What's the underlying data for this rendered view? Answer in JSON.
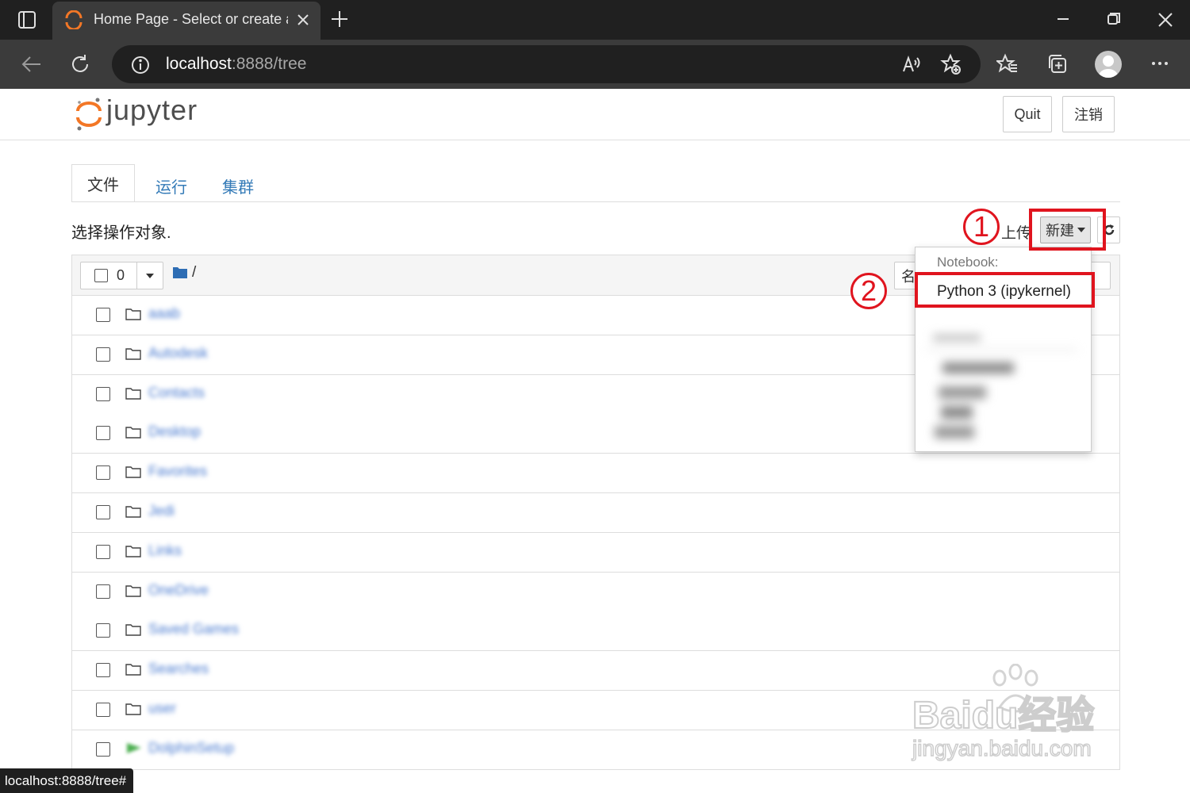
{
  "browser": {
    "tab_title": "Home Page - Select or create a n",
    "url_host": "localhost",
    "url_rest": ":8888/tree",
    "status_url": "localhost:8888/tree#"
  },
  "header": {
    "logo_text": "jupyter",
    "quit_label": "Quit",
    "logout_label": "注销"
  },
  "tabs": [
    {
      "label": "文件"
    },
    {
      "label": "运行"
    },
    {
      "label": "集群"
    }
  ],
  "toolbar": {
    "select_text": "选择操作对象.",
    "upload_label": "上传",
    "new_label": "新建",
    "selected_count": "0",
    "breadcrumb": "/",
    "sort_label": "名"
  },
  "dropdown": {
    "section_header": "Notebook:",
    "python_item": "Python 3 (ipykernel)"
  },
  "annotations": {
    "step1": "1",
    "step2": "2"
  },
  "files": [
    {
      "name": "aaab"
    },
    {
      "name": "Autodesk"
    },
    {
      "name": "Contacts"
    },
    {
      "name": "Desktop"
    },
    {
      "name": "Favorites"
    },
    {
      "name": "Jedi"
    },
    {
      "name": "Links"
    },
    {
      "name": "OneDrive"
    },
    {
      "name": "Saved Games"
    },
    {
      "name": "Searches"
    },
    {
      "name": "user"
    },
    {
      "name": "DolphinSetup"
    }
  ],
  "watermark": {
    "brand": "Baidu经验",
    "url": "jingyan.baidu.com"
  },
  "colors": {
    "accent_red": "#e0141e",
    "link_blue": "#337ab7",
    "jupyter_orange": "#f37726"
  }
}
